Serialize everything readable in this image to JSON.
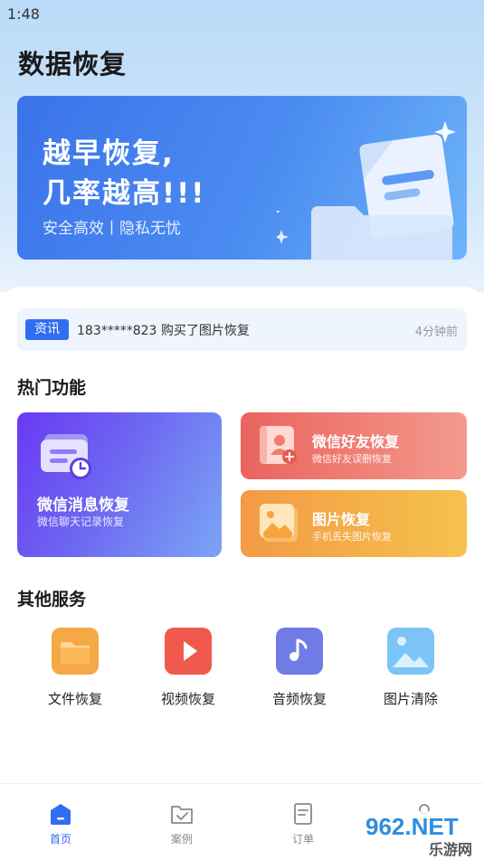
{
  "status_bar": {
    "time": "1:48"
  },
  "app": {
    "title": "数据恢复"
  },
  "banner": {
    "line1": "越早恢复,",
    "line2": "几率越高!!!",
    "subtitle": "安全高效丨隐私无忧"
  },
  "news": {
    "tag": "资讯",
    "text": "183*****823 购买了图片恢复",
    "time": "4分钟前"
  },
  "hot_features": {
    "title": "热门功能",
    "items": [
      {
        "title": "微信消息恢复",
        "subtitle": "微信聊天记录恢复",
        "icon": "chat-clock-icon"
      },
      {
        "title": "微信好友恢复",
        "subtitle": "微信好友误删恢复",
        "icon": "contact-add-icon"
      },
      {
        "title": "图片恢复",
        "subtitle": "手机丢失图片恢复",
        "icon": "picture-icon"
      }
    ]
  },
  "other_services": {
    "title": "其他服务",
    "items": [
      {
        "label": "文件恢复",
        "icon": "folder-icon"
      },
      {
        "label": "视频恢复",
        "icon": "play-icon"
      },
      {
        "label": "音频恢复",
        "icon": "music-note-icon"
      },
      {
        "label": "图片清除",
        "icon": "image-icon"
      }
    ]
  },
  "bottom_nav": {
    "items": [
      {
        "label": "首页",
        "icon": "home-icon",
        "active": true
      },
      {
        "label": "案例",
        "icon": "folder-check-icon",
        "active": false
      },
      {
        "label": "订单",
        "icon": "document-icon",
        "active": false
      },
      {
        "label": "",
        "icon": "profile-icon",
        "active": false
      }
    ]
  },
  "watermark": {
    "text": "962.NET",
    "sub": "乐游网"
  },
  "colors": {
    "accent": "#2f6ef1",
    "hot_purple": "#6a39f3",
    "hot_red": "#ea645f",
    "hot_orange": "#f39a45"
  }
}
